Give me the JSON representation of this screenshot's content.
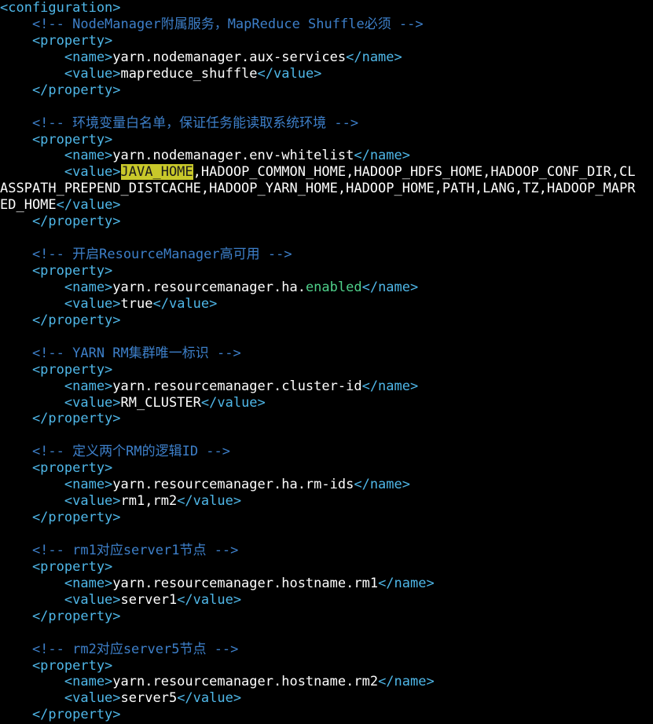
{
  "editor": {
    "colors": {
      "background": "#000000",
      "tag": "#4fb7e8",
      "comment": "#3d7fc9",
      "text": "#ffffff",
      "keyword": "#4fd08a",
      "highlight": "#c8c82a"
    },
    "lines": [
      [
        [
          "tag",
          "<configuration>"
        ]
      ],
      [
        [
          "cm",
          "    <!-- NodeManager附属服务，MapReduce Shuffle必须 -->"
        ]
      ],
      [
        [
          "tag",
          "    <property>"
        ]
      ],
      [
        [
          "tag",
          "        <name>"
        ],
        [
          "txt",
          "yarn.nodemanager.aux-services"
        ],
        [
          "tag",
          "</name>"
        ]
      ],
      [
        [
          "tag",
          "        <value>"
        ],
        [
          "txt",
          "mapreduce_shuffle"
        ],
        [
          "tag",
          "</value>"
        ]
      ],
      [
        [
          "tag",
          "    </property>"
        ]
      ],
      [],
      [
        [
          "cm",
          "    <!-- 环境变量白名单，保证任务能读取系统环境 -->"
        ]
      ],
      [
        [
          "tag",
          "    <property>"
        ]
      ],
      [
        [
          "tag",
          "        <name>"
        ],
        [
          "txt",
          "yarn.nodemanager.env-whitelist"
        ],
        [
          "tag",
          "</name>"
        ]
      ],
      [
        [
          "tag",
          "        <value>"
        ],
        [
          "hl",
          "JAVA_HOME"
        ],
        [
          "txt",
          ",HADOOP_COMMON_HOME,HADOOP_HDFS_HOME,HADOOP_CONF_DIR,CL"
        ]
      ],
      [
        [
          "txt",
          "ASSPATH_PREPEND_DISTCACHE,HADOOP_YARN_HOME,HADOOP_HOME,PATH,LANG,TZ,HADOOP_MAPR"
        ]
      ],
      [
        [
          "txt",
          "ED_HOME"
        ],
        [
          "tag",
          "</value>"
        ]
      ],
      [
        [
          "tag",
          "    </property>"
        ]
      ],
      [],
      [
        [
          "cm",
          "    <!-- 开启ResourceManager高可用 -->"
        ]
      ],
      [
        [
          "tag",
          "    <property>"
        ]
      ],
      [
        [
          "tag",
          "        <name>"
        ],
        [
          "txt",
          "yarn.resourcemanager.ha."
        ],
        [
          "kw",
          "enabled"
        ],
        [
          "tag",
          "</name>"
        ]
      ],
      [
        [
          "tag",
          "        <value>"
        ],
        [
          "txt",
          "true"
        ],
        [
          "tag",
          "</value>"
        ]
      ],
      [
        [
          "tag",
          "    </property>"
        ]
      ],
      [],
      [
        [
          "cm",
          "    <!-- YARN RM集群唯一标识 -->"
        ]
      ],
      [
        [
          "tag",
          "    <property>"
        ]
      ],
      [
        [
          "tag",
          "        <name>"
        ],
        [
          "txt",
          "yarn.resourcemanager.cluster-id"
        ],
        [
          "tag",
          "</name>"
        ]
      ],
      [
        [
          "tag",
          "        <value>"
        ],
        [
          "txt",
          "RM_CLUSTER"
        ],
        [
          "tag",
          "</value>"
        ]
      ],
      [
        [
          "tag",
          "    </property>"
        ]
      ],
      [],
      [
        [
          "cm",
          "    <!-- 定义两个RM的逻辑ID -->"
        ]
      ],
      [
        [
          "tag",
          "    <property>"
        ]
      ],
      [
        [
          "tag",
          "        <name>"
        ],
        [
          "txt",
          "yarn.resourcemanager.ha.rm-ids"
        ],
        [
          "tag",
          "</name>"
        ]
      ],
      [
        [
          "tag",
          "        <value>"
        ],
        [
          "txt",
          "rm1,rm2"
        ],
        [
          "tag",
          "</value>"
        ]
      ],
      [
        [
          "tag",
          "    </property>"
        ]
      ],
      [],
      [
        [
          "cm",
          "    <!-- rm1对应server1节点 -->"
        ]
      ],
      [
        [
          "tag",
          "    <property>"
        ]
      ],
      [
        [
          "tag",
          "        <name>"
        ],
        [
          "txt",
          "yarn.resourcemanager.hostname.rm1"
        ],
        [
          "tag",
          "</name>"
        ]
      ],
      [
        [
          "tag",
          "        <value>"
        ],
        [
          "txt",
          "server1"
        ],
        [
          "tag",
          "</value>"
        ]
      ],
      [
        [
          "tag",
          "    </property>"
        ]
      ],
      [],
      [
        [
          "cm",
          "    <!-- rm2对应server5节点 -->"
        ]
      ],
      [
        [
          "tag",
          "    <property>"
        ]
      ],
      [
        [
          "tag",
          "        <name>"
        ],
        [
          "txt",
          "yarn.resourcemanager.hostname.rm2"
        ],
        [
          "tag",
          "</name>"
        ]
      ],
      [
        [
          "tag",
          "        <value>"
        ],
        [
          "txt",
          "server5"
        ],
        [
          "tag",
          "</value>"
        ]
      ],
      [
        [
          "tag",
          "    </property>"
        ]
      ]
    ]
  }
}
